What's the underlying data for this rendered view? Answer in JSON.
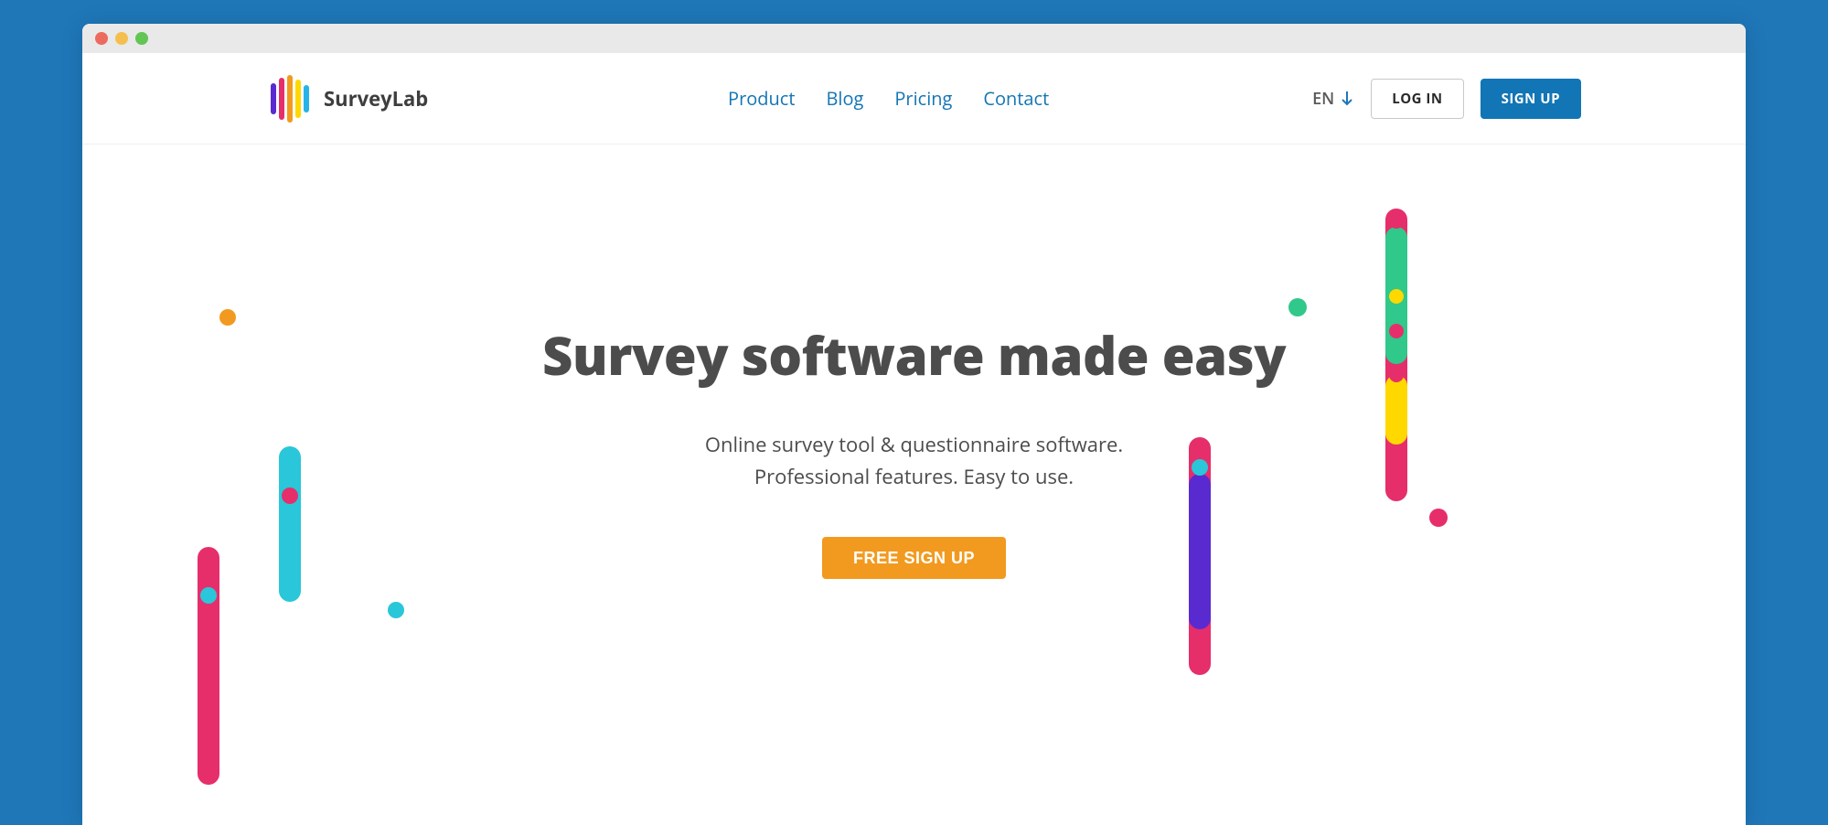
{
  "brand": {
    "name": "SurveyLab"
  },
  "nav": {
    "items": [
      {
        "label": "Product"
      },
      {
        "label": "Blog"
      },
      {
        "label": "Pricing"
      },
      {
        "label": "Contact"
      }
    ]
  },
  "header": {
    "language": "EN",
    "login_label": "LOG IN",
    "signup_label": "SIGN UP"
  },
  "hero": {
    "title": "Survey software made easy",
    "subtitle_line1": "Online survey tool & questionnaire software.",
    "subtitle_line2": "Professional features. Easy to use.",
    "cta_label": "FREE SIGN UP"
  }
}
